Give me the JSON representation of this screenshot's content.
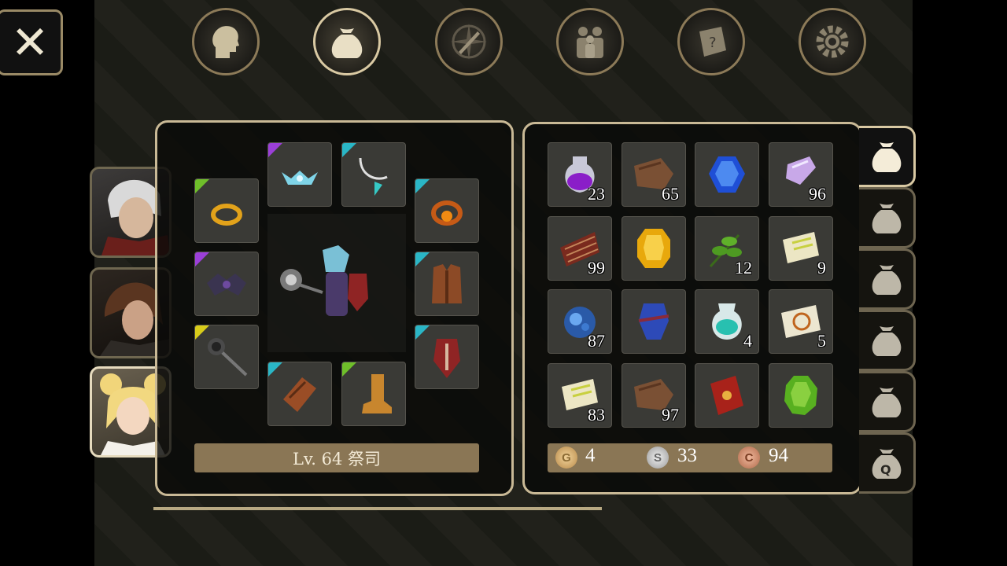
{
  "nav": {
    "tabs": [
      {
        "name": "character",
        "icon": "head-icon"
      },
      {
        "name": "inventory",
        "icon": "bag-icon",
        "active": true
      },
      {
        "name": "skills",
        "icon": "sword-compass-icon"
      },
      {
        "name": "party",
        "icon": "people-icon"
      },
      {
        "name": "quests",
        "icon": "scroll-question-icon"
      },
      {
        "name": "settings",
        "icon": "gear-icon"
      }
    ]
  },
  "equipment": {
    "level_text": "Lv. 64 祭司",
    "slots": [
      {
        "slot": "ring-left",
        "icon": "gold-ring-icon",
        "rarity_color": "#6fbf2a"
      },
      {
        "slot": "head",
        "icon": "tiara-icon",
        "rarity_color": "#9b3fd8"
      },
      {
        "slot": "neck",
        "icon": "necklace-icon",
        "rarity_color": "#2ab6c6"
      },
      {
        "slot": "ring-right",
        "icon": "ruby-ring-icon",
        "rarity_color": "#2ab6c6"
      },
      {
        "slot": "shoulders",
        "icon": "dark-pauldron-icon",
        "rarity_color": "#9b3fd8"
      },
      {
        "slot": "body",
        "icon": "leather-armor-icon",
        "rarity_color": "#2ab6c6"
      },
      {
        "slot": "weapon",
        "icon": "mace-icon",
        "rarity_color": "#d8cc1a"
      },
      {
        "slot": "offhand",
        "icon": "shield-icon",
        "rarity_color": "#2ab6c6"
      },
      {
        "slot": "hands",
        "icon": "gauntlet-icon",
        "rarity_color": "#2ab6c6"
      },
      {
        "slot": "feet",
        "icon": "boot-icon",
        "rarity_color": "#6fbf2a"
      }
    ]
  },
  "party": [
    {
      "name": "white-haired-warrior",
      "active": false
    },
    {
      "name": "brown-haired-rogue",
      "active": false
    },
    {
      "name": "blonde-priest",
      "active": true
    }
  ],
  "inventory": {
    "items": [
      {
        "icon": "purple-potion-icon",
        "qty": "23"
      },
      {
        "icon": "leather-hide-icon",
        "qty": "65"
      },
      {
        "icon": "blue-gem-icon",
        "qty": ""
      },
      {
        "icon": "crystal-shard-icon",
        "qty": "96"
      },
      {
        "icon": "quills-icon",
        "qty": "99"
      },
      {
        "icon": "topaz-gem-icon",
        "qty": ""
      },
      {
        "icon": "herb-leaf-icon",
        "qty": "12"
      },
      {
        "icon": "scroll-icon",
        "qty": "9"
      },
      {
        "icon": "blue-ore-icon",
        "qty": "87"
      },
      {
        "icon": "blue-cloth-icon",
        "qty": ""
      },
      {
        "icon": "teal-vase-icon",
        "qty": "4"
      },
      {
        "icon": "rune-scroll-icon",
        "qty": "5"
      },
      {
        "icon": "scroll-icon",
        "qty": "83"
      },
      {
        "icon": "leather-hide-icon",
        "qty": "97"
      },
      {
        "icon": "red-book-icon",
        "qty": ""
      },
      {
        "icon": "emerald-gem-icon",
        "qty": ""
      }
    ],
    "currency": {
      "gold": {
        "label": "G",
        "value": "4"
      },
      "silver": {
        "label": "S",
        "value": "33"
      },
      "copper": {
        "label": "C",
        "value": "94"
      }
    },
    "bag_tabs": [
      {
        "icon": "bag-icon",
        "active": true
      },
      {
        "icon": "bag-icon",
        "active": false
      },
      {
        "icon": "bag-icon",
        "active": false
      },
      {
        "icon": "bag-icon",
        "active": false
      },
      {
        "icon": "bag-icon",
        "active": false
      },
      {
        "icon": "quest-bag-icon",
        "label": "Q",
        "active": false
      }
    ]
  },
  "close_label": "✕"
}
